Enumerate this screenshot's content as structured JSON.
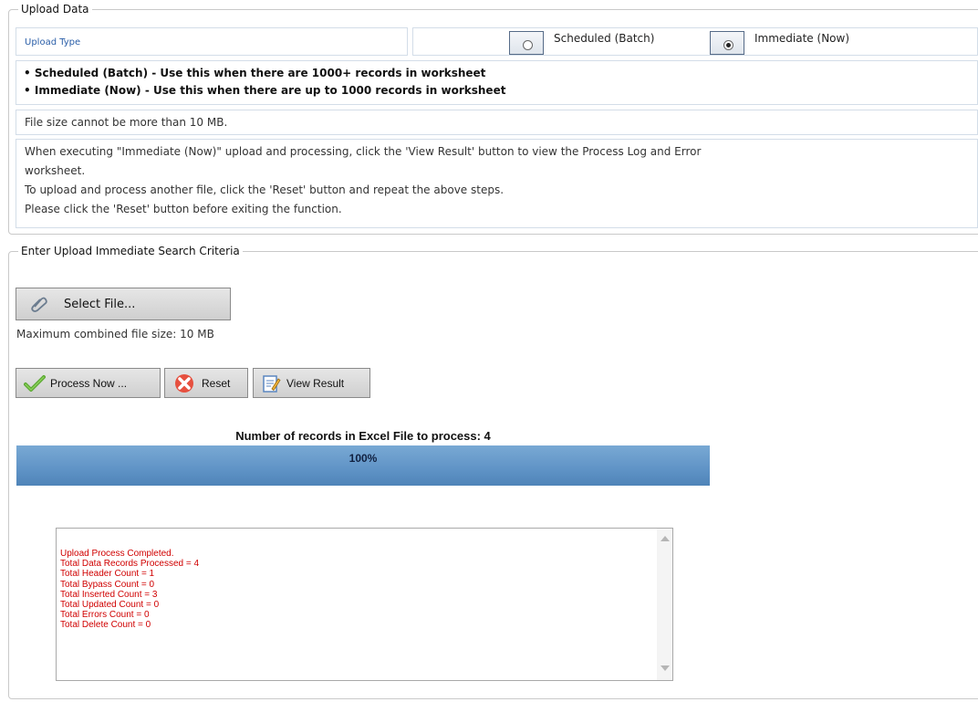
{
  "upload_data": {
    "legend": "Upload Data",
    "upload_type_label": "Upload Type",
    "options": [
      {
        "label": "Scheduled (Batch)",
        "selected": false
      },
      {
        "label": "Immediate (Now)",
        "selected": true
      }
    ],
    "bullets": [
      "Scheduled (Batch) - Use this when there are 1000+ records in worksheet",
      "Immediate (Now) - Use this when there are up to 1000 records in worksheet"
    ],
    "file_size_note": "File size cannot be more than 10 MB.",
    "instructions": [
      "When executing \"Immediate (Now)\" upload and processing, click the 'View Result' button to view the Process Log and Error",
      "worksheet.",
      "To upload and process another file, click the 'Reset' button and repeat the above steps.",
      "Please click the 'Reset' button before exiting the function."
    ]
  },
  "search_criteria": {
    "legend": "Enter Upload Immediate Search Criteria",
    "select_file_label": "Select File...",
    "max_size_note": "Maximum combined file size: 10 MB",
    "buttons": {
      "process": "Process Now ...",
      "reset": "Reset",
      "view_result": "View Result"
    },
    "records_caption": "Number of records in Excel File to process: 4",
    "progress": {
      "percent": 100,
      "label": "100%"
    },
    "log_lines": [
      "Upload Process Completed.",
      "Total Data Records Processed = 4",
      "Total Header Count = 1",
      "Total Bypass Count = 0",
      "Total Inserted Count = 3",
      "Total Updated Count = 0",
      "Total Errors Count = 0",
      "Total Delete Count = 0"
    ]
  },
  "icons": {
    "select_file": "paperclip-icon",
    "process": "checkmark-icon",
    "reset": "red-x-icon",
    "view_result": "document-pencil-icon"
  },
  "colors": {
    "log_text": "#d00000",
    "progress_fill": "#5f93c6",
    "upload_type_label": "#2a5ea8"
  }
}
